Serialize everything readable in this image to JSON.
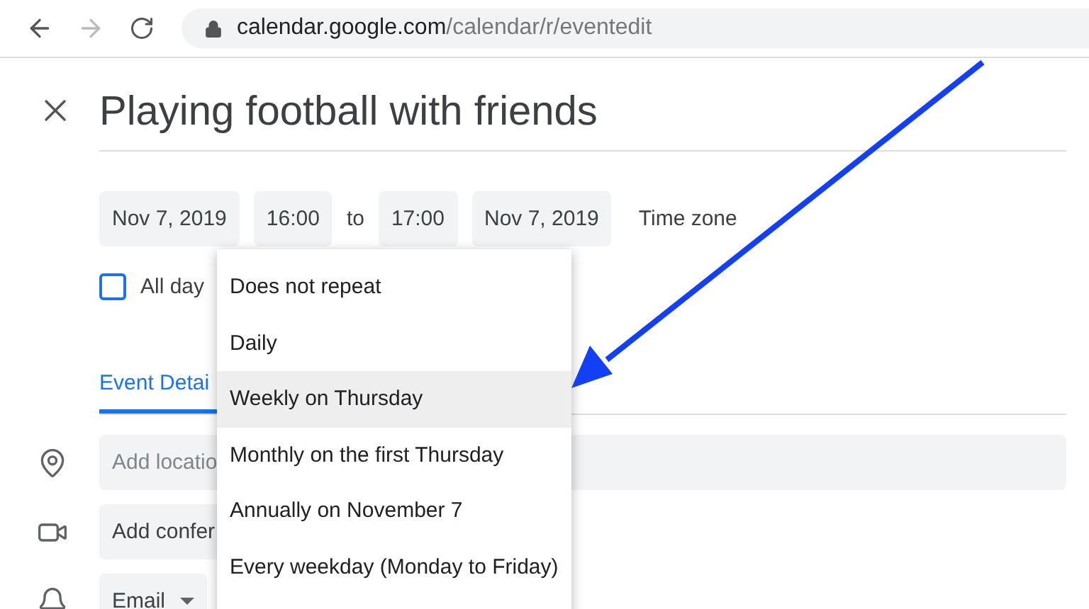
{
  "browser": {
    "url_host": "calendar.google.com",
    "url_path": "/calendar/r/eventedit"
  },
  "event": {
    "title": "Playing football with friends",
    "start_date": "Nov 7, 2019",
    "start_time": "16:00",
    "separator": "to",
    "end_time": "17:00",
    "end_date": "Nov 7, 2019",
    "time_zone": "Time zone",
    "all_day": {
      "label": "All day",
      "checked": false
    }
  },
  "tabs": [
    {
      "label": "Event Detai",
      "selected": true
    }
  ],
  "location": {
    "placeholder": "Add locatio"
  },
  "conferencing": {
    "label": "Add confer"
  },
  "notification": {
    "label": "Email"
  },
  "repeat_menu": [
    {
      "label": "Does not repeat",
      "selected": false
    },
    {
      "label": "Daily",
      "selected": false
    },
    {
      "label": "Weekly on Thursday",
      "selected": true
    },
    {
      "label": "Monthly on the first Thursday",
      "selected": false
    },
    {
      "label": "Annually on November 7",
      "selected": false
    },
    {
      "label": "Every weekday (Monday to Friday)",
      "selected": false
    }
  ]
}
